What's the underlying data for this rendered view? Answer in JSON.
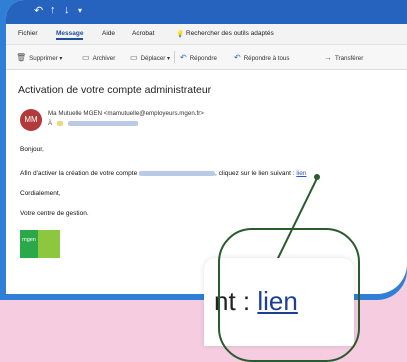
{
  "ribbon": {
    "tabs": [
      "Fichier",
      "Message",
      "Aide",
      "Acrobat"
    ],
    "search_label": "Rechercher des outils adaptés"
  },
  "toolbar": {
    "delete_label": "Supprimer",
    "archive_label": "Archiver",
    "move_label": "Déplacer",
    "reply_label": "Répondre",
    "reply_all_label": "Répondre à tous",
    "forward_label": "Transférer"
  },
  "email": {
    "subject": "Activation de votre compte administrateur",
    "avatar_initials": "MM",
    "sender": "Ma Mutuelle MGEN <mamutuelle@employeurs.mgen.fr>",
    "to_prefix": "À",
    "greeting": "Bonjour,",
    "line1_start": "Afin d'activer la création de votre compte",
    "line1_end": ", cliquez sur le lien suivant :",
    "link_text": "lien",
    "closing": "Cordialement,",
    "signature": "Votre centre de gestion."
  },
  "logo": {
    "text": "mgen"
  },
  "zoom": {
    "text_prefix": "nt : ",
    "link_text": "lien"
  }
}
